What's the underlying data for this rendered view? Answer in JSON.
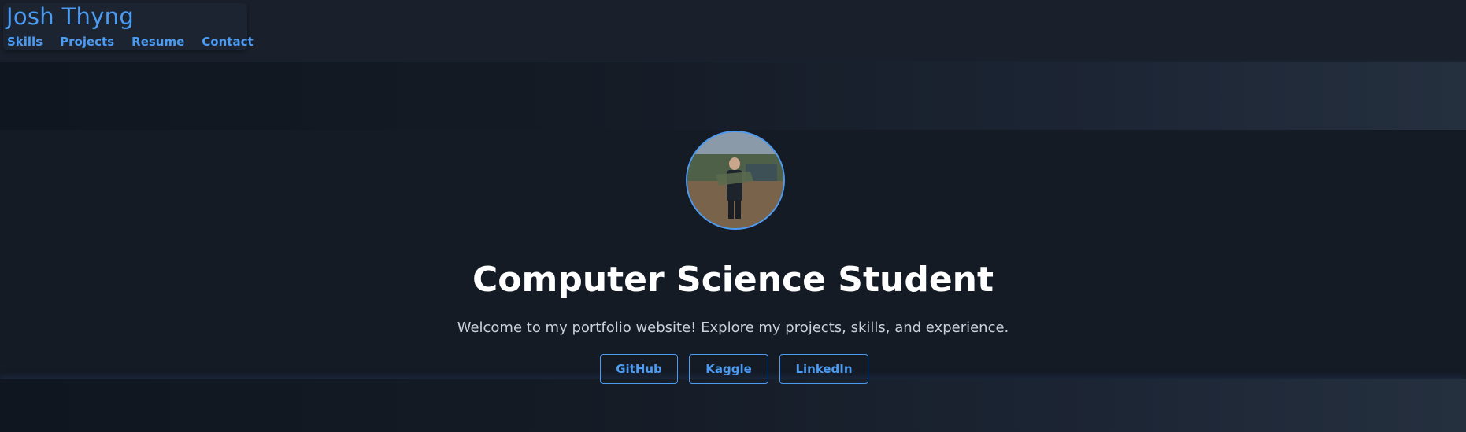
{
  "header": {
    "site_title": "Josh Thyng",
    "nav": [
      {
        "label": "Skills"
      },
      {
        "label": "Projects"
      },
      {
        "label": "Resume"
      },
      {
        "label": "Contact"
      }
    ]
  },
  "hero": {
    "title": "Computer Science Student",
    "subtitle": "Welcome to my portfolio website! Explore my projects, skills, and experience.",
    "buttons": [
      {
        "label": "GitHub"
      },
      {
        "label": "Kaggle"
      },
      {
        "label": "LinkedIn"
      }
    ]
  },
  "colors": {
    "accent": "#4b9bf3",
    "background": "#151b25",
    "title_text": "#ffffff",
    "subtitle_text": "#c9d1db"
  }
}
